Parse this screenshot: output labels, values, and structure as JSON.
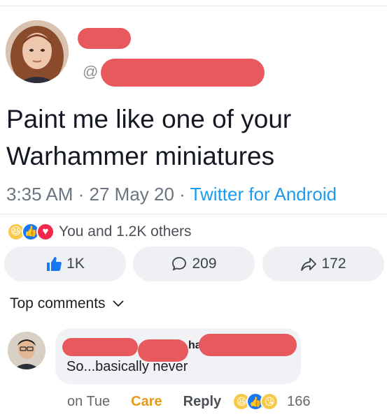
{
  "tweet": {
    "handle_prefix": "@",
    "text": "Paint me like one of your Warhammer miniatures",
    "time": "3:35 AM",
    "separator": " · ",
    "date": "27 May 20",
    "app": "Twitter for Android"
  },
  "reactions": {
    "summary": "You and 1.2K others",
    "icons": [
      "haha-icon",
      "like-icon",
      "love-icon"
    ],
    "icon_glyphs": [
      "😆",
      "👍",
      "♥"
    ]
  },
  "actions": {
    "like_count": "1K",
    "comment_count": "209",
    "share_count": "172"
  },
  "comments_header": {
    "label": "Top comments"
  },
  "comment": {
    "partial_name": "ha",
    "text": "So...basically never",
    "time": "on Tue",
    "care_label": "Care",
    "reply_label": "Reply",
    "reaction_glyphs": [
      "😆",
      "👍",
      "😘"
    ],
    "reaction_count": "166"
  },
  "colors": {
    "redaction": "#e8595e",
    "link_blue": "#1d9bf0",
    "care_orange": "#e39b1b",
    "like_blue": "#1877f2"
  }
}
